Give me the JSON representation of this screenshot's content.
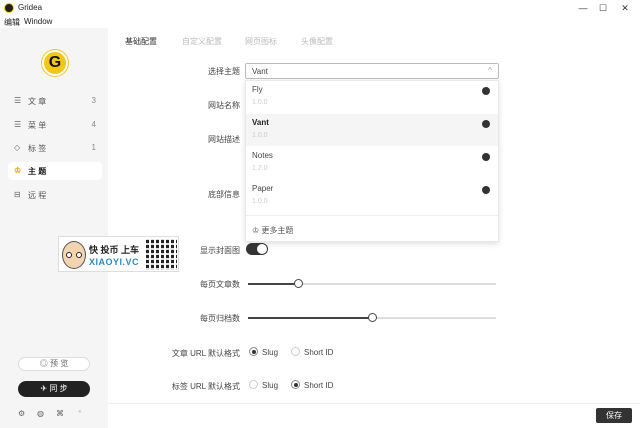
{
  "window": {
    "title": "Gridea",
    "controls": [
      "—",
      "☐",
      "✕"
    ]
  },
  "menubar": {
    "items": [
      "编辑",
      "Window"
    ]
  },
  "sidebar": {
    "items": [
      {
        "icon": "☰",
        "label": "文 章",
        "count": "3"
      },
      {
        "icon": "☰",
        "label": "菜 单",
        "count": "4"
      },
      {
        "icon": "◇",
        "label": "标 签",
        "count": "1"
      },
      {
        "icon": "♔",
        "label": "主 题",
        "count": ""
      },
      {
        "icon": "⊟",
        "label": "远 程",
        "count": ""
      }
    ],
    "preview_label": "◎ 预 览",
    "sync_label": "✈ 同 步",
    "bottom_icons": [
      "⚙",
      "◍",
      "⌘",
      "●"
    ]
  },
  "tabs": [
    "基础配置",
    "自定义配置",
    "网页图标",
    "头像配置"
  ],
  "form": {
    "theme_label": "选择主题",
    "theme_value": "Vant",
    "site_name_label": "网站名称",
    "site_desc_label": "网站描述",
    "footer_label": "底部信息",
    "cover_label": "显示封面图",
    "posts_per_page_label": "每页文章数",
    "posts_per_page_level": 0.2,
    "archive_per_page_label": "每页归档数",
    "archive_per_page_level": 0.5,
    "post_url_label": "文章 URL 默认格式",
    "tag_url_label": "标签 URL 默认格式",
    "slug_label": "Slug",
    "shortid_label": "Short ID"
  },
  "dropdown": {
    "options": [
      {
        "name": "Fly",
        "version": "1.0.0"
      },
      {
        "name": "Vant",
        "version": "1.0.0"
      },
      {
        "name": "Notes",
        "version": "1.2.0"
      },
      {
        "name": "Paper",
        "version": "1.0.0"
      }
    ],
    "more_label": "♔ 更多主题"
  },
  "banner": {
    "line1": "快 投币 上车",
    "line2": "XIAOYI.VC"
  },
  "save_label": "保存"
}
